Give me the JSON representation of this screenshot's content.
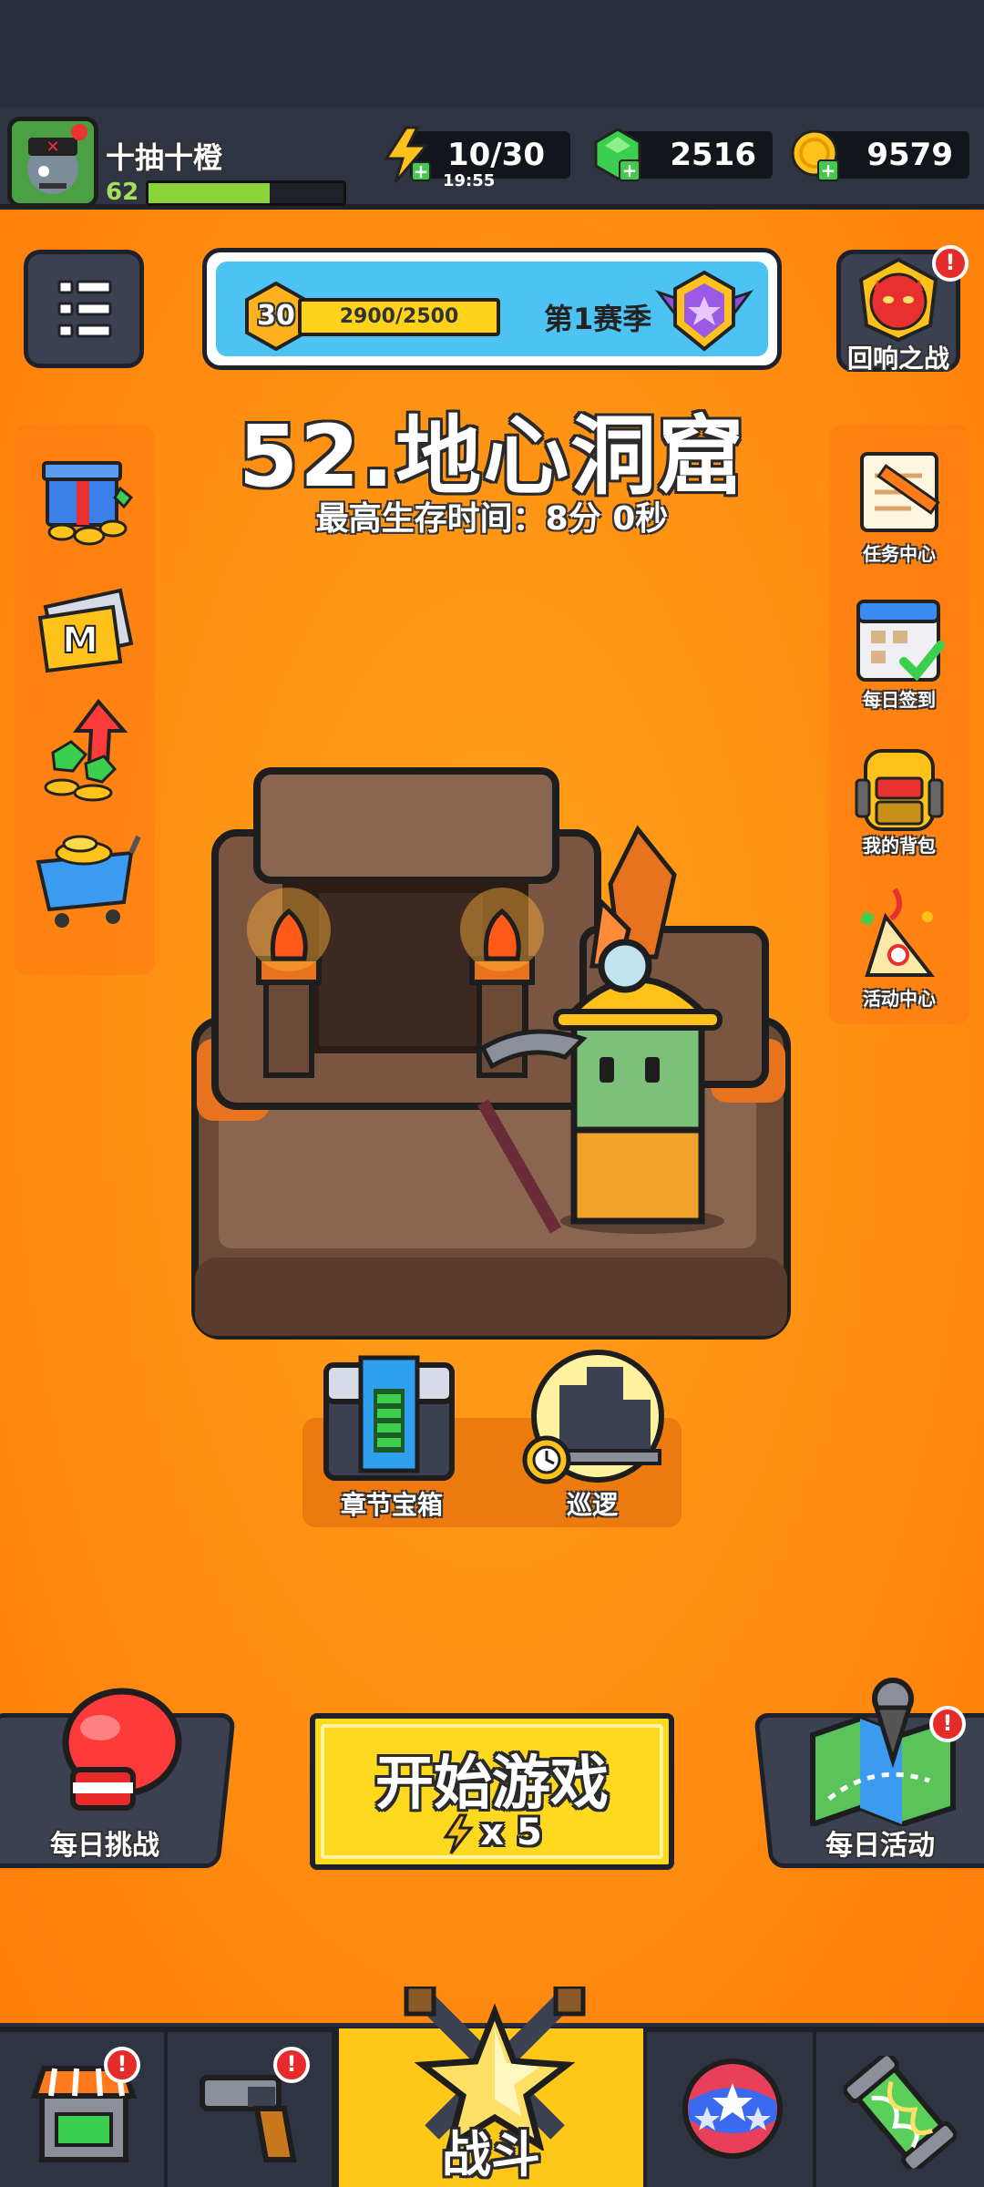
{
  "player": {
    "name": "十抽十橙",
    "level": "62",
    "xp_fraction": 0.62
  },
  "resources": {
    "energy": "10/30",
    "energy_timer": "19:55",
    "gems": "2516",
    "gold": "9579"
  },
  "season": {
    "level": "30",
    "progress": "2900/2500",
    "progress_fraction": 1.0,
    "name": "第1赛季"
  },
  "echo_battle": {
    "label": "回响之战",
    "badge": "!"
  },
  "stage": {
    "title": "52.地心洞窟",
    "subtitle": "最高生存时间：8分 0秒"
  },
  "left_sidebar": [
    {
      "icon": "gift-icon"
    },
    {
      "icon": "monthly-card-icon"
    },
    {
      "icon": "growth-gems-icon"
    },
    {
      "icon": "shop-cart-icon"
    }
  ],
  "right_sidebar": [
    {
      "icon": "task-scroll-icon",
      "label": "任务中心"
    },
    {
      "icon": "calendar-check-icon",
      "label": "每日签到"
    },
    {
      "icon": "backpack-icon",
      "label": "我的背包"
    },
    {
      "icon": "party-popper-icon",
      "label": "活动中心"
    }
  ],
  "chapter_chest": {
    "label": "章节宝箱"
  },
  "patrol": {
    "label": "巡逻"
  },
  "daily_challenge": {
    "label": "每日挑战"
  },
  "start_game": {
    "label": "开始游戏",
    "cost": "x 5"
  },
  "daily_event": {
    "label": "每日活动",
    "badge": "!"
  },
  "bottom_nav": {
    "tabs": [
      {
        "name": "shop",
        "icon": "shop-stall-icon",
        "badge": "!"
      },
      {
        "name": "weapons",
        "icon": "pistol-icon",
        "badge": "!"
      },
      {
        "name": "battle",
        "icon": "star-swords-icon",
        "label": "战斗"
      },
      {
        "name": "talents",
        "icon": "star-ball-icon"
      },
      {
        "name": "evolution",
        "icon": "dna-capsule-icon"
      }
    ]
  },
  "colors": {
    "background_orange": "#ff8f12",
    "hud_dark": "#2f3442",
    "accent_yellow": "#ffd820",
    "alert_red": "#e62b2b",
    "gem_green": "#3ccf4e"
  }
}
